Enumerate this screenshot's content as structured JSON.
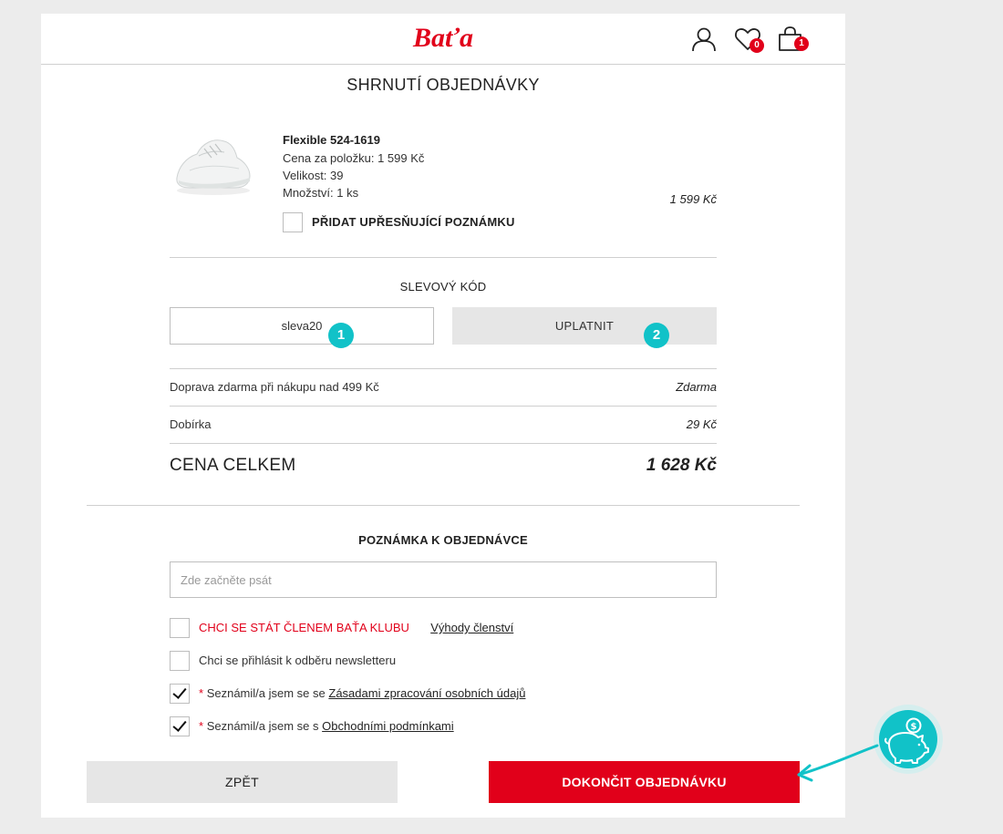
{
  "header": {
    "logo_text": "Baťa",
    "wishlist_count": "0",
    "cart_count": "1"
  },
  "page_title": "SHRNUTÍ OBJEDNÁVKY",
  "product": {
    "name": "Flexible 524-1619",
    "price_per_item": "Cena za položku: 1 599 Kč",
    "size": "Velikost: 39",
    "quantity": "Množství: 1 ks",
    "line_total": "1 599 Kč",
    "note_option": "PŘIDAT UPŘESŇUJÍCÍ POZNÁMKU"
  },
  "discount": {
    "title": "SLEVOVÝ KÓD",
    "code_value": "sleva20",
    "apply_label": "UPLATNIT",
    "marker_1": "1",
    "marker_2": "2"
  },
  "summary": {
    "shipping_label": "Doprava zdarma při nákupu nad 499 Kč",
    "shipping_value": "Zdarma",
    "cod_label": "Dobírka",
    "cod_value": "29 Kč",
    "total_label": "CENA CELKEM",
    "total_value": "1 628 Kč"
  },
  "order_note": {
    "title": "POZNÁMKA K OBJEDNÁVCE",
    "placeholder": "Zde začněte psát"
  },
  "checkboxes": {
    "club_label": "CHCI SE STÁT ČLENEM BAŤA KLUBU",
    "club_link": "Výhody členství",
    "newsletter_label": "Chci se přihlásit k odběru newsletteru",
    "required_mark": "*",
    "privacy_prefix": "Seznámil/a jsem se se",
    "privacy_link": "Zásadami zpracování osobních údajů",
    "terms_prefix": "Seznámil/a jsem se s",
    "terms_link": "Obchodními podmínkami"
  },
  "buttons": {
    "back_label": "ZPĚT",
    "finish_label": "DOKONČIT OBJEDNÁVKU"
  },
  "colors": {
    "brand_red": "#e1001a",
    "accent_teal": "#11c2c8"
  }
}
